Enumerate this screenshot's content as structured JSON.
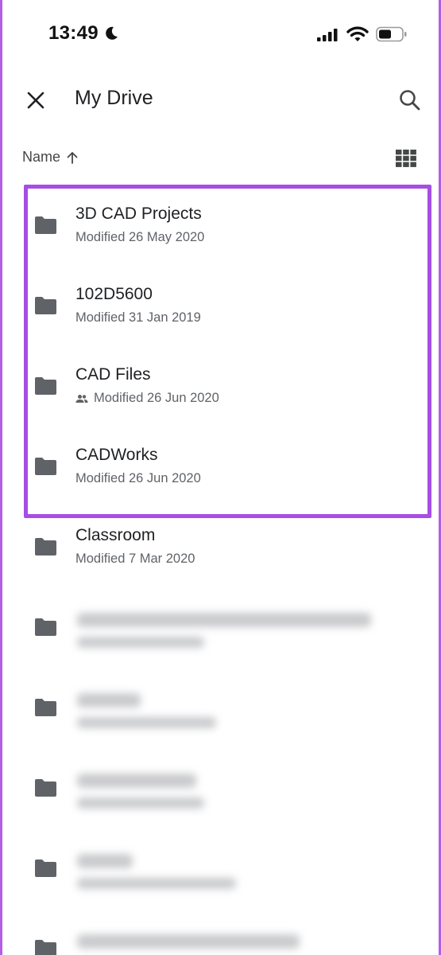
{
  "status_bar": {
    "time": "13:49",
    "icons": [
      "moon-icon",
      "signal-icon",
      "wifi-icon",
      "battery-icon"
    ]
  },
  "header": {
    "title": "My Drive",
    "close_icon": "close-icon",
    "search_icon": "search-icon"
  },
  "sort": {
    "label": "Name",
    "direction_icon": "arrow-up-icon",
    "view_icon": "grid-view-icon"
  },
  "files": [
    {
      "name": "3D CAD Projects",
      "meta": "Modified 26 May 2020",
      "shared": false
    },
    {
      "name": "102D5600",
      "meta": "Modified 31 Jan 2019",
      "shared": false
    },
    {
      "name": "CAD Files",
      "meta": "Modified 26 Jun 2020",
      "shared": true
    },
    {
      "name": "CADWorks",
      "meta": "Modified 26 Jun 2020",
      "shared": false
    },
    {
      "name": "Classroom",
      "meta": "Modified 7 Mar 2020",
      "shared": false
    }
  ],
  "blurred_rows": 5,
  "colors": {
    "highlight_border": "#a64ee5",
    "frame_border": "#b45de6",
    "folder_icon": "#5f6368",
    "text_primary": "#202124",
    "text_secondary": "#5f6368"
  }
}
